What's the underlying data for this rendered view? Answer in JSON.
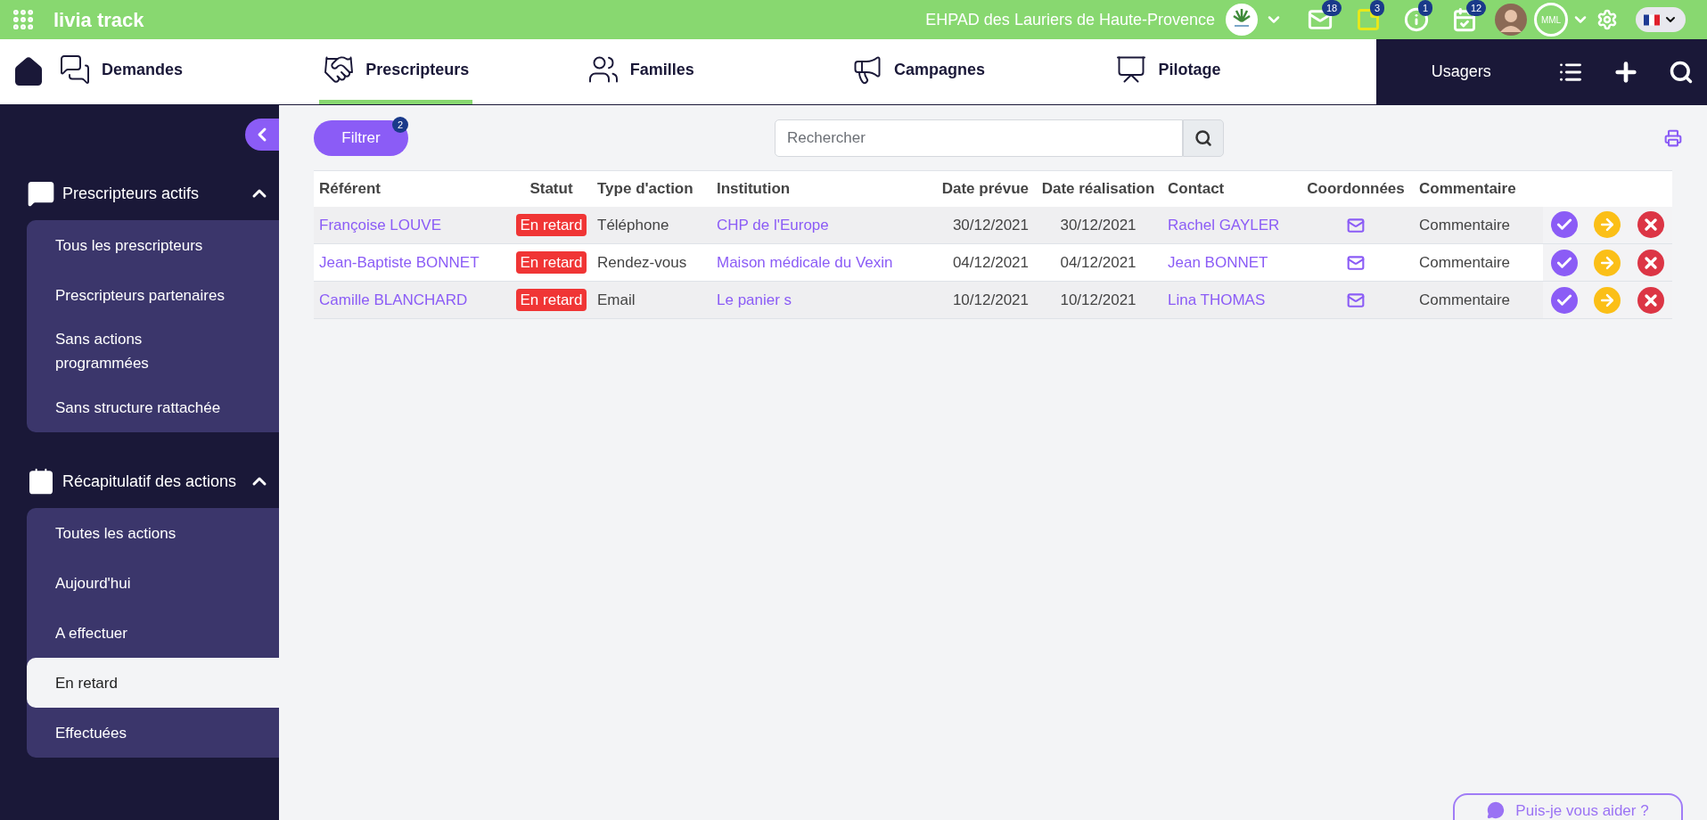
{
  "top_bar": {
    "app_name": "livia track",
    "establishment": "EHPAD des Lauriers de Haute-Provence",
    "notifications": [
      {
        "kind": "mail",
        "count": "18"
      },
      {
        "kind": "note",
        "count": "3"
      },
      {
        "kind": "info",
        "count": "1"
      },
      {
        "kind": "tasks",
        "count": "12"
      }
    ],
    "avatar_initials": "MML"
  },
  "nav": {
    "items": [
      {
        "kind": "requests",
        "label": "Demandes",
        "selected": false
      },
      {
        "kind": "handshake",
        "label": "Prescripteurs",
        "selected": true
      },
      {
        "kind": "family",
        "label": "Familles",
        "selected": false
      },
      {
        "kind": "megaphone",
        "label": "Campagnes",
        "selected": false
      },
      {
        "kind": "chart",
        "label": "Pilotage",
        "selected": false
      }
    ],
    "usagers": "Usagers"
  },
  "sidebar": {
    "sections": [
      {
        "kind": "chat",
        "title": "Prescripteurs actifs",
        "expanded": true,
        "items": [
          {
            "label": "Tous les prescripteurs",
            "selected": false
          },
          {
            "label": "Prescripteurs partenaires",
            "selected": false
          },
          {
            "label": "Sans actions programmées",
            "selected": false
          },
          {
            "label": "Sans structure rattachée",
            "selected": false
          }
        ]
      },
      {
        "kind": "calendar",
        "title": "Récapitulatif des actions",
        "expanded": true,
        "items": [
          {
            "label": "Toutes les actions",
            "selected": false
          },
          {
            "label": "Aujourd'hui",
            "selected": false
          },
          {
            "label": "A effectuer",
            "selected": false
          },
          {
            "label": "En retard",
            "selected": true
          },
          {
            "label": "Effectuées",
            "selected": false
          }
        ]
      }
    ]
  },
  "toolbar": {
    "filter": {
      "label": "Filtrer",
      "count": "2"
    },
    "search": {
      "placeholder": "Rechercher"
    }
  },
  "table": {
    "columns": [
      "Référent",
      "Statut",
      "Type d'action",
      "Institution",
      "Date prévue",
      "Date réalisation",
      "Contact",
      "Coordonnées",
      "Commentaire"
    ],
    "rows": [
      {
        "referent": "Françoise LOUVE",
        "status": "En retard",
        "action_type": "Téléphone",
        "institution": "CHP de l'Europe",
        "date_planned": "30/12/2021",
        "date_done": "30/12/2021",
        "contact": "Rachel GAYLER",
        "comment": "Commentaire"
      },
      {
        "referent": "Jean-Baptiste BONNET",
        "status": "En retard",
        "action_type": "Rendez-vous",
        "institution": "Maison médicale du Vexin",
        "date_planned": "04/12/2021",
        "date_done": "04/12/2021",
        "contact": "Jean BONNET",
        "comment": "Commentaire"
      },
      {
        "referent": "Camille BLANCHARD",
        "status": "En retard",
        "action_type": "Email",
        "institution": "Le panier s",
        "date_planned": "10/12/2021",
        "date_done": "10/12/2021",
        "contact": "Lina THOMAS",
        "comment": "Commentaire"
      }
    ]
  },
  "help_button": "Puis-je vous aider ?"
}
